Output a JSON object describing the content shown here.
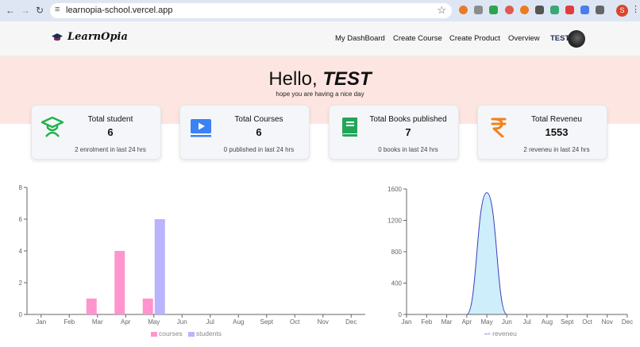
{
  "browser": {
    "url": "learnopia-school.vercel.app",
    "profile_initial": "S"
  },
  "header": {
    "logo_text": "LearnOpia",
    "nav": [
      "My DashBoard",
      "Create Course",
      "Create Product",
      "Overview"
    ],
    "user": "TEST"
  },
  "hero": {
    "greeting": "Hello,",
    "name": "TEST",
    "subtitle": "hope you are having a nice day"
  },
  "cards": [
    {
      "title": "Total student",
      "value": "6",
      "sub": "2 enrolment in last 24 hrs",
      "icon": "graduate-icon",
      "color": "#22b14c"
    },
    {
      "title": "Total Courses",
      "value": "6",
      "sub": "0 published in last 24 hrs",
      "icon": "video-play-icon",
      "color": "#3b82f6"
    },
    {
      "title": "Total Books published",
      "value": "7",
      "sub": "0 books in last 24 hrs",
      "icon": "book-icon",
      "color": "#22a55a"
    },
    {
      "title": "Total Reveneu",
      "value": "1553",
      "sub": "2 reveneu in last 24 hrs",
      "icon": "rupee-icon",
      "color": "#f0821e"
    }
  ],
  "chart_data": [
    {
      "type": "bar",
      "categories": [
        "Jan",
        "Feb",
        "Mar",
        "Apr",
        "May",
        "Jun",
        "Jul",
        "Aug",
        "Sept",
        "Oct",
        "Nov",
        "Dec"
      ],
      "series": [
        {
          "name": "courses",
          "color": "#ff94cf",
          "values": [
            0,
            0,
            1,
            4,
            1,
            0,
            0,
            0,
            0,
            0,
            0,
            0
          ]
        },
        {
          "name": "students",
          "color": "#b9b4fb",
          "values": [
            0,
            0,
            0,
            0,
            6,
            0,
            0,
            0,
            0,
            0,
            0,
            0
          ]
        }
      ],
      "yticks": [
        0,
        2,
        4,
        6,
        8
      ],
      "ylim": [
        0,
        8
      ],
      "legend": "bottom"
    },
    {
      "type": "area",
      "categories": [
        "Jan",
        "Feb",
        "Mar",
        "Apr",
        "May",
        "Jun",
        "Jul",
        "Aug",
        "Sept",
        "Oct",
        "Nov",
        "Dec"
      ],
      "series": [
        {
          "name": "reveneu",
          "color": "#3c3cbf",
          "fill": "#cdeefa",
          "values": [
            0,
            0,
            0,
            0,
            1553,
            0,
            0,
            0,
            0,
            0,
            0,
            0
          ]
        }
      ],
      "yticks": [
        0,
        400,
        800,
        1200,
        1600
      ],
      "ylim": [
        0,
        1600
      ],
      "legend": "bottom"
    }
  ]
}
